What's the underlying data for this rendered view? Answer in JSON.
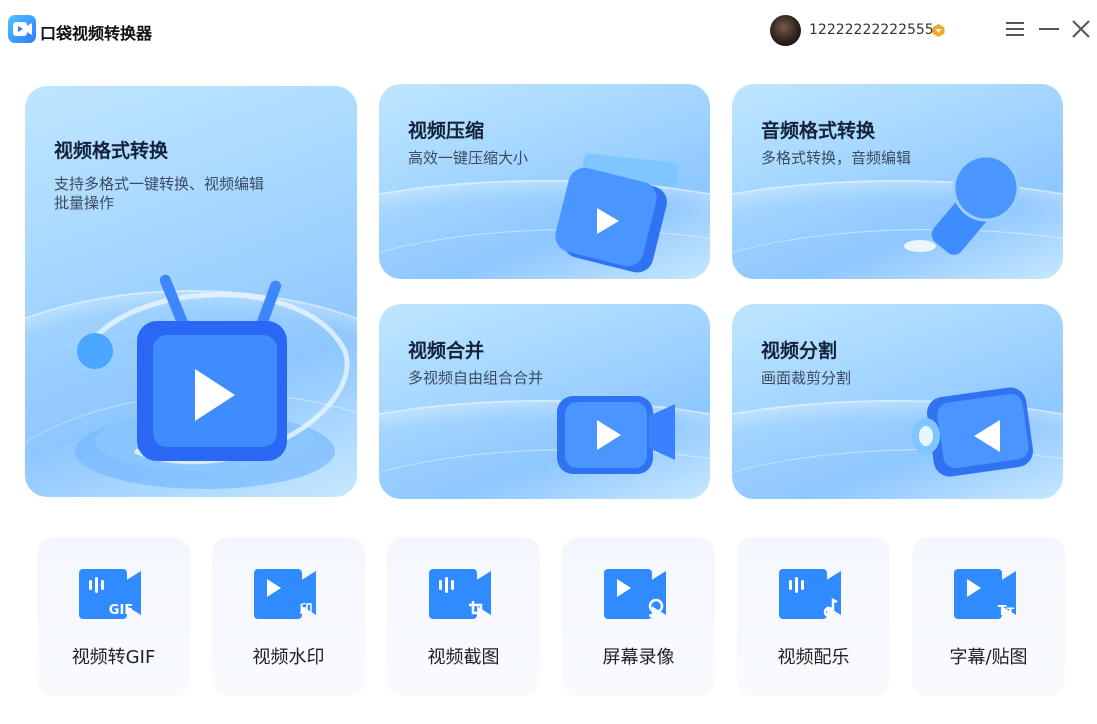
{
  "app": {
    "title": "口袋视频转换器",
    "logo_icon": "video-app-logo-icon"
  },
  "user": {
    "id": "12222222222555",
    "badge_icon": "vip-diamond-icon"
  },
  "window_controls": {
    "menu_icon": "hamburger-icon",
    "minimize_icon": "minimize-icon",
    "close_icon": "close-icon"
  },
  "features": [
    {
      "title": "视频格式转换",
      "desc_line1": "支持多格式一键转换、视频编辑",
      "desc_line2": "批量操作",
      "icon": "tv-play-icon"
    },
    {
      "title": "视频压缩",
      "desc": "高效一键压缩大小",
      "icon": "clapperboard-icon"
    },
    {
      "title": "音频格式转换",
      "desc": "多格式转换，音频编辑",
      "icon": "microphone-icon"
    },
    {
      "title": "视频合并",
      "desc": "多视频自由组合合并",
      "icon": "video-camera-icon"
    },
    {
      "title": "视频分割",
      "desc": "画面裁剪分割",
      "icon": "projector-icon"
    }
  ],
  "tools": [
    {
      "label": "视频转GIF",
      "badge": "GIF",
      "icon": "video-gif-icon"
    },
    {
      "label": "视频水印",
      "badge": "印",
      "icon": "video-watermark-icon"
    },
    {
      "label": "视频截图",
      "badge": "crop",
      "icon": "video-crop-icon"
    },
    {
      "label": "屏幕录像",
      "badge": "webcam",
      "icon": "screen-record-icon"
    },
    {
      "label": "视频配乐",
      "badge": "note",
      "icon": "video-music-icon"
    },
    {
      "label": "字幕/贴图",
      "badge": "Tт",
      "icon": "subtitle-sticker-icon"
    }
  ],
  "colors": {
    "accent": "#2f8bff",
    "card_bg": "#a7d8ff",
    "tile_bg": "#f5f8fd"
  }
}
